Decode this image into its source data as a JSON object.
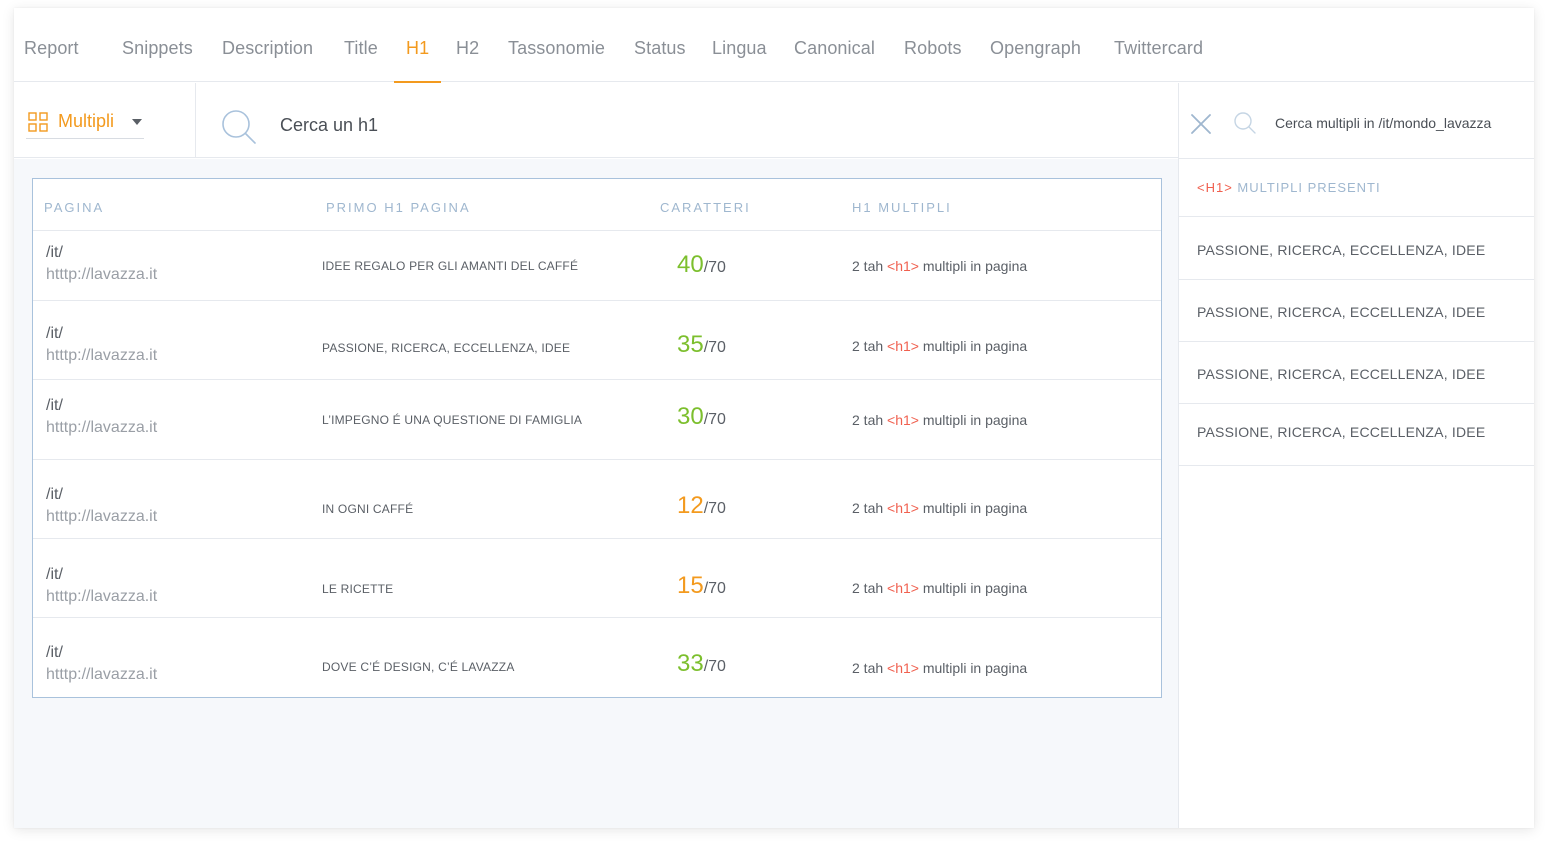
{
  "tabs": [
    {
      "label": "Report"
    },
    {
      "label": "Snippets"
    },
    {
      "label": "Description"
    },
    {
      "label": "Title"
    },
    {
      "label": "H1"
    },
    {
      "label": "H2"
    },
    {
      "label": "Tassonomie"
    },
    {
      "label": "Status"
    },
    {
      "label": "Lingua"
    },
    {
      "label": "Canonical"
    },
    {
      "label": "Robots"
    },
    {
      "label": "Opengraph"
    },
    {
      "label": "Twittercard"
    }
  ],
  "active_tab": "H1",
  "toolbar": {
    "filter_label": "Multipli",
    "filter_icon": "grid-icon",
    "search_placeholder": "Cerca un h1"
  },
  "table": {
    "headers": {
      "pagina": "PAGINA",
      "primo_h1": "PRIMO H1 PAGINA",
      "caratteri": "CARATTERI",
      "h1_multipli": "H1 MULTIPLI"
    },
    "rows": [
      {
        "path": "/it/",
        "url": "htttp://lavazza.it",
        "h1": "IDEE REGALO PER GLI AMANTI DEL CAFFÉ",
        "chars": "40",
        "max": "/70",
        "status": "green",
        "multi_prefix": "2 tah ",
        "multi_tag": "<h1>",
        "multi_suffix": " multipli in pagina"
      },
      {
        "path": "/it/",
        "url": "htttp://lavazza.it",
        "h1": "PASSIONE, RICERCA, ECCELLENZA, IDEE",
        "chars": "35",
        "max": "/70",
        "status": "green",
        "multi_prefix": "2 tah ",
        "multi_tag": "<h1>",
        "multi_suffix": " multipli in pagina"
      },
      {
        "path": "/it/",
        "url": "htttp://lavazza.it",
        "h1": "L’IMPEGNO É UNA QUESTIONE DI FAMIGLIA",
        "chars": "30",
        "max": "/70",
        "status": "green",
        "multi_prefix": "2 tah ",
        "multi_tag": "<h1>",
        "multi_suffix": " multipli in pagina"
      },
      {
        "path": "/it/",
        "url": "htttp://lavazza.it",
        "h1": "IN OGNI CAFFÉ",
        "chars": "12",
        "max": "/70",
        "status": "orange",
        "multi_prefix": "2 tah ",
        "multi_tag": "<h1>",
        "multi_suffix": " multipli in pagina"
      },
      {
        "path": "/it/",
        "url": "htttp://lavazza.it",
        "h1": "LE RICETTE",
        "chars": "15",
        "max": "/70",
        "status": "orange",
        "multi_prefix": "2 tah ",
        "multi_tag": "<h1>",
        "multi_suffix": " multipli in pagina"
      },
      {
        "path": "/it/",
        "url": "htttp://lavazza.it",
        "h1": "DOVE C’É DESIGN, C’É LAVAZZA",
        "chars": "33",
        "max": "/70",
        "status": "green",
        "multi_prefix": "2 tah ",
        "multi_tag": "<h1>",
        "multi_suffix": " multipli in pagina"
      }
    ]
  },
  "panel": {
    "search_placeholder": "Cerca multipli in /it/mondo_lavazza",
    "title_tag": "<H1>",
    "title_text": " MULTIPLI PRESENTI",
    "items": [
      {
        "label": "PASSIONE, RICERCA, ECCELLENZA, IDEE"
      },
      {
        "label": "PASSIONE, RICERCA, ECCELLENZA, IDEE"
      },
      {
        "label": "PASSIONE, RICERCA, ECCELLENZA, IDEE"
      },
      {
        "label": "PASSIONE, RICERCA, ECCELLENZA, IDEE"
      }
    ]
  },
  "colors": {
    "accent": "#f39a1e",
    "good": "#7cbf2d",
    "warning": "#f39a1e",
    "tag": "#f0604f",
    "header_text": "#9fb7cf"
  }
}
